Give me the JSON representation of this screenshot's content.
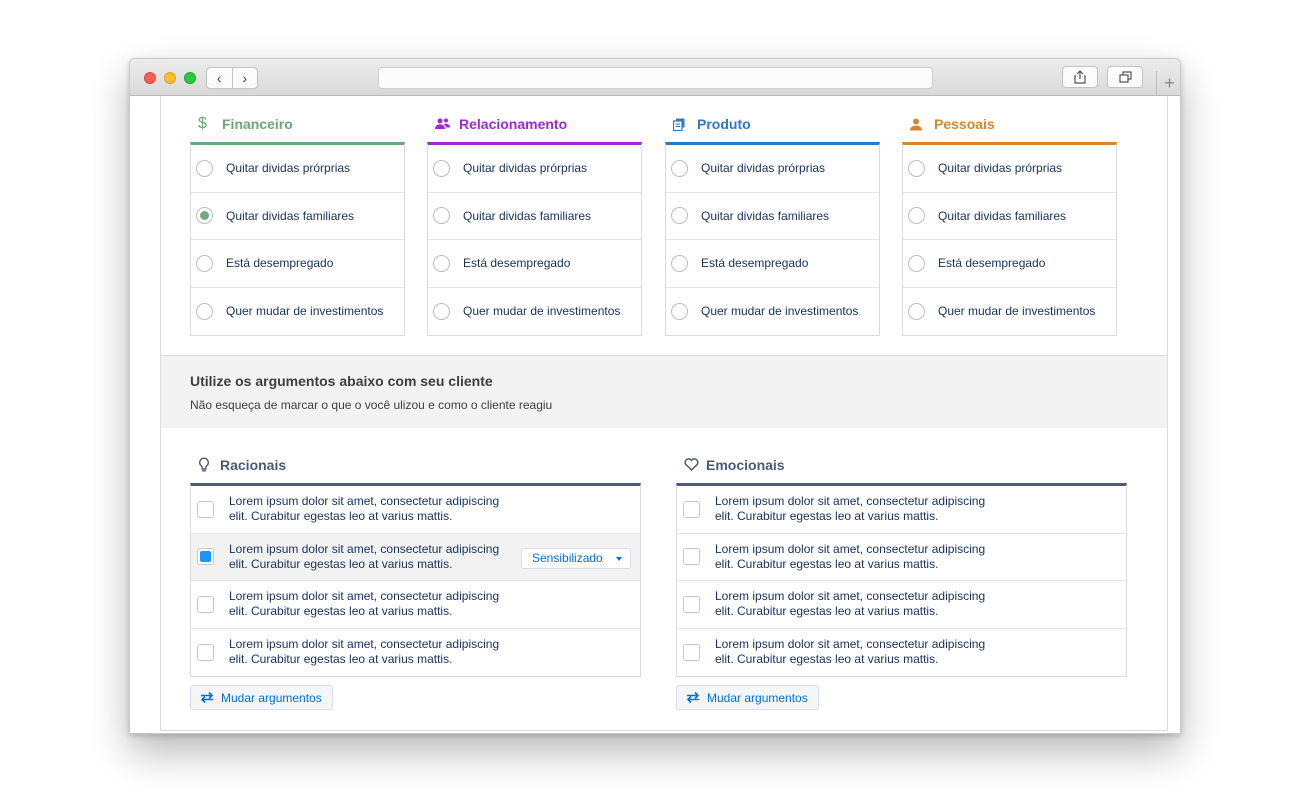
{
  "categories": [
    {
      "title": "Financeiro",
      "icon": "dollar-icon",
      "color": "#6aa77a",
      "options": [
        "Quitar dividas prórprias",
        "Quitar dividas familiares",
        "Está desempregado",
        "Quer mudar de investimentos"
      ],
      "selected": 1
    },
    {
      "title": "Relacionamento",
      "icon": "people-icon",
      "color": "#9c2ad0",
      "options": [
        "Quitar dividas prórprias",
        "Quitar dividas familiares",
        "Está desempregado",
        "Quer mudar de investimentos"
      ],
      "selected": -1
    },
    {
      "title": "Produto",
      "icon": "product-icon",
      "color": "#2f78c8",
      "options": [
        "Quitar dividas prórprias",
        "Quitar dividas familiares",
        "Está desempregado",
        "Quer mudar de investimentos"
      ],
      "selected": -1
    },
    {
      "title": "Pessoais",
      "icon": "person-icon",
      "color": "#d9862b",
      "options": [
        "Quitar dividas prórprias",
        "Quitar dividas familiares",
        "Está desempregado",
        "Quer mudar de investimentos"
      ],
      "selected": -1
    }
  ],
  "band": {
    "title": "Utilize os argumentos abaixo com seu cliente",
    "subtitle": "Não esqueça de marcar o que o você ulizou e como o cliente reagiu"
  },
  "arguments": {
    "racionais": {
      "title": "Racionais",
      "icon": "lightbulb-icon",
      "items": [
        "Lorem ipsum dolor sit amet, consectetur adipiscing elit. Curabitur egestas leo at varius mattis.",
        "Lorem ipsum dolor sit amet, consectetur adipiscing elit. Curabitur egestas leo at varius mattis.",
        "Lorem ipsum dolor sit amet, consectetur adipiscing elit. Curabitur egestas leo at varius mattis.",
        "Lorem ipsum dolor sit amet, consectetur adipiscing elit. Curabitur egestas leo at varius mattis."
      ],
      "checked_index": 1,
      "reaction_value": "Sensibilizado",
      "button_label": "Mudar argumentos"
    },
    "emocionais": {
      "title": "Emocionais",
      "icon": "heart-icon",
      "items": [
        "Lorem ipsum dolor sit amet, consectetur adipiscing elit. Curabitur egestas leo at varius mattis.",
        "Lorem ipsum dolor sit amet, consectetur adipiscing elit. Curabitur egestas leo at varius mattis.",
        "Lorem ipsum dolor sit amet, consectetur adipiscing elit. Curabitur egestas leo at varius mattis.",
        "Lorem ipsum dolor sit amet, consectetur adipiscing elit. Curabitur egestas leo at varius mattis."
      ],
      "button_label": "Mudar argumentos"
    }
  },
  "colors": {
    "accent_blue": "#0070d2",
    "argument_rule": "#4c5a80"
  }
}
